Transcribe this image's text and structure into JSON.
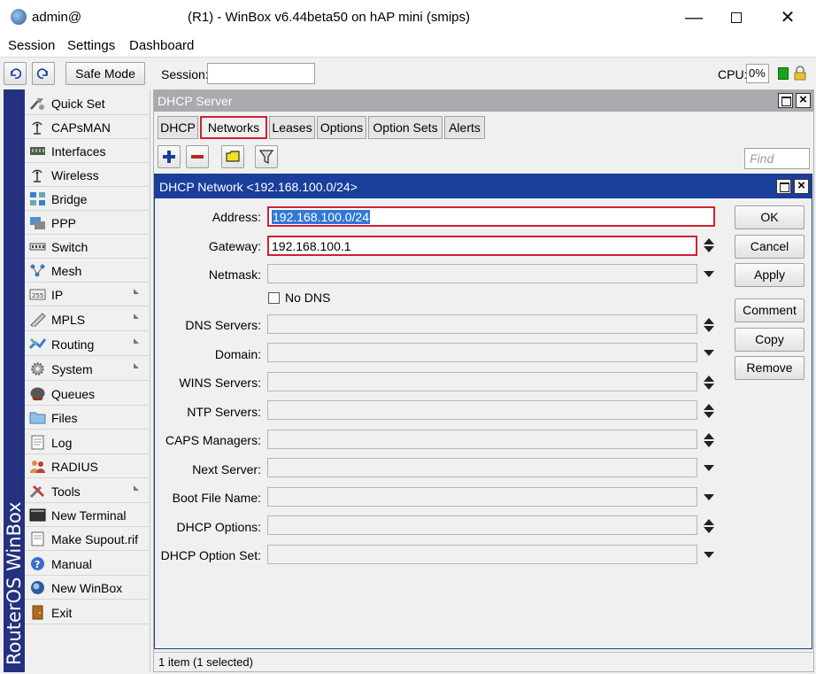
{
  "window": {
    "user": "admin@",
    "title": "(R1) - WinBox v6.44beta50 on hAP mini (smips)"
  },
  "menu": [
    "Session",
    "Settings",
    "Dashboard"
  ],
  "toolbar": {
    "safe_mode": "Safe Mode",
    "session_label": "Session:",
    "session_value": "",
    "cpu_label": "CPU:",
    "cpu_value": "0%"
  },
  "brand": "RouterOS WinBox",
  "sidebar": {
    "items": [
      {
        "label": "Quick Set",
        "icon": "quick-set-icon",
        "submenu": false
      },
      {
        "label": "CAPsMAN",
        "icon": "capsman-icon",
        "submenu": false
      },
      {
        "label": "Interfaces",
        "icon": "interfaces-icon",
        "submenu": false
      },
      {
        "label": "Wireless",
        "icon": "wireless-icon",
        "submenu": false
      },
      {
        "label": "Bridge",
        "icon": "bridge-icon",
        "submenu": false
      },
      {
        "label": "PPP",
        "icon": "ppp-icon",
        "submenu": false
      },
      {
        "label": "Switch",
        "icon": "switch-icon",
        "submenu": false
      },
      {
        "label": "Mesh",
        "icon": "mesh-icon",
        "submenu": false
      },
      {
        "label": "IP",
        "icon": "ip-icon",
        "submenu": true
      },
      {
        "label": "MPLS",
        "icon": "mpls-icon",
        "submenu": true
      },
      {
        "label": "Routing",
        "icon": "routing-icon",
        "submenu": true
      },
      {
        "label": "System",
        "icon": "system-icon",
        "submenu": true
      },
      {
        "label": "Queues",
        "icon": "queues-icon",
        "submenu": false
      },
      {
        "label": "Files",
        "icon": "files-icon",
        "submenu": false
      },
      {
        "label": "Log",
        "icon": "log-icon",
        "submenu": false
      },
      {
        "label": "RADIUS",
        "icon": "radius-icon",
        "submenu": false
      },
      {
        "label": "Tools",
        "icon": "tools-icon",
        "submenu": true
      },
      {
        "label": "New Terminal",
        "icon": "terminal-icon",
        "submenu": false
      },
      {
        "label": "Make Supout.rif",
        "icon": "supout-icon",
        "submenu": false
      },
      {
        "label": "Manual",
        "icon": "manual-icon",
        "submenu": false
      },
      {
        "label": "New WinBox",
        "icon": "winbox-icon",
        "submenu": false
      },
      {
        "label": "Exit",
        "icon": "exit-icon",
        "submenu": false
      }
    ]
  },
  "dhcp_server": {
    "title": "DHCP Server",
    "tabs": [
      {
        "label": "DHCP",
        "active": false
      },
      {
        "label": "Networks",
        "active": true
      },
      {
        "label": "Leases",
        "active": false
      },
      {
        "label": "Options",
        "active": false
      },
      {
        "label": "Option Sets",
        "active": false
      },
      {
        "label": "Alerts",
        "active": false
      }
    ],
    "find_placeholder": "Find",
    "status": "1 item (1 selected)"
  },
  "dialog": {
    "title": "DHCP Network <192.168.100.0/24>",
    "fields": [
      {
        "label": "Address:",
        "value": "192.168.100.0/24",
        "control": "none"
      },
      {
        "label": "Gateway:",
        "value": "192.168.100.1",
        "control": "updown"
      },
      {
        "label": "Netmask:",
        "value": "",
        "control": "dropdown"
      },
      {
        "label": "DNS Servers:",
        "value": "",
        "control": "updown"
      },
      {
        "label": "Domain:",
        "value": "",
        "control": "dropdown"
      },
      {
        "label": "WINS Servers:",
        "value": "",
        "control": "updown"
      },
      {
        "label": "NTP Servers:",
        "value": "",
        "control": "updown"
      },
      {
        "label": "CAPS Managers:",
        "value": "",
        "control": "updown"
      },
      {
        "label": "Next Server:",
        "value": "",
        "control": "dropdown"
      },
      {
        "label": "Boot File Name:",
        "value": "",
        "control": "dropdown"
      },
      {
        "label": "DHCP Options:",
        "value": "",
        "control": "updown"
      },
      {
        "label": "DHCP Option Set:",
        "value": "",
        "control": "dropdown"
      }
    ],
    "no_dns_label": "No DNS",
    "buttons": {
      "ok": "OK",
      "cancel": "Cancel",
      "apply": "Apply",
      "comment": "Comment",
      "copy": "Copy",
      "remove": "Remove"
    }
  },
  "colors": {
    "highlight_red": "#d02030",
    "dialog_title_blue": "#1a3e9b",
    "brand_blue": "#24317f"
  }
}
